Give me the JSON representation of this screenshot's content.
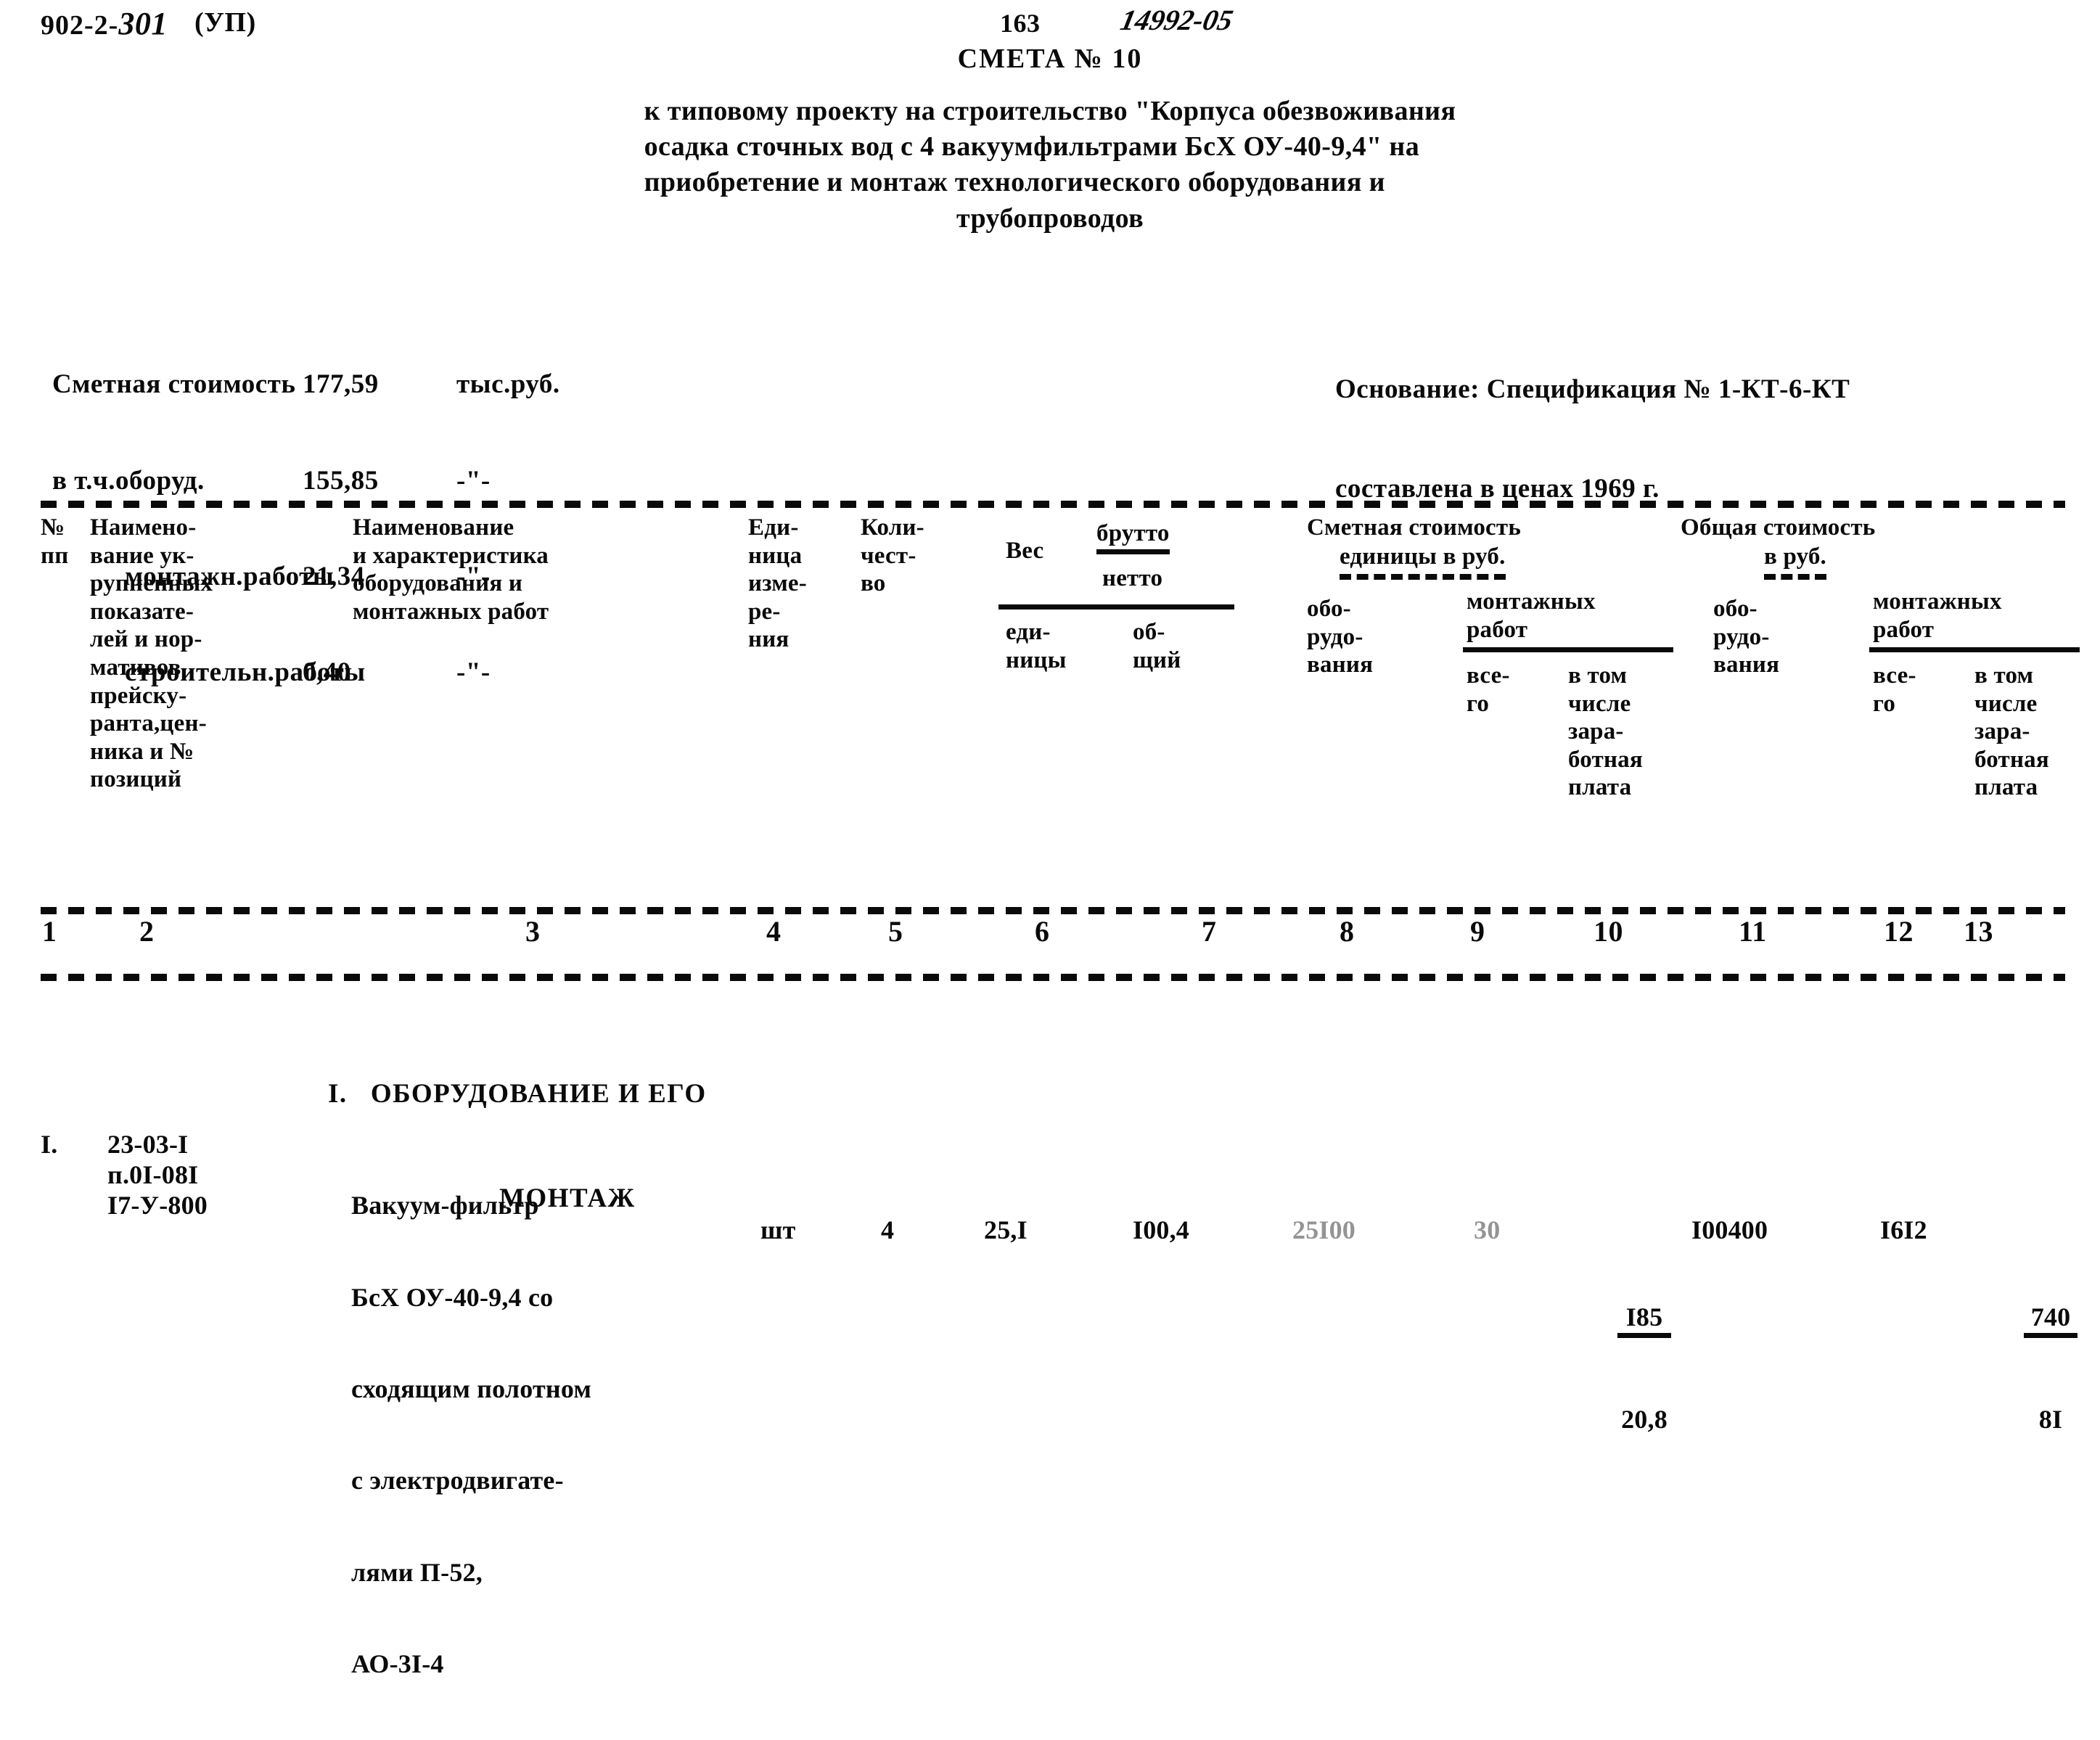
{
  "header": {
    "project_code_typed": "902-2-",
    "project_code_hand": "301",
    "stage_mark": "(УП)",
    "page_number": "163",
    "archive_number": "14992-05"
  },
  "title": {
    "doc_title": "СМЕТА № 10",
    "lines": [
      "к типовому проекту на строительство \"Корпуса обезвоживания",
      "осадка сточных вод с 4 вакуумфильтрами БсХ ОУ-40-9,4\" на",
      "приобретение и монтаж технологического оборудования и",
      "трубопроводов"
    ]
  },
  "summary": {
    "rows": [
      {
        "label": "Сметная стоимость",
        "value": "177,59",
        "unit": "тыс.руб."
      },
      {
        "label": "в т.ч.оборуд.",
        "value": "155,85",
        "unit": "-\"-"
      },
      {
        "label": "монтажн.работы",
        "value": "21,34",
        "unit": "-\"-"
      },
      {
        "label": "строительн.работы",
        "value": "0,40",
        "unit": "-\"-"
      }
    ]
  },
  "basis": {
    "line1": "Основание: Спецификация № 1-КТ-6-КТ",
    "line2": "составлена в ценах 1969 г."
  },
  "table": {
    "headers": {
      "col1": "№\nпп",
      "col2": "Наимено-\nвание ук-\nрупненных\nпоказате-\nлей и нор-\nмативов\nпрейску-\nранта,цен-\nника и №\nпозиций",
      "col3": "Наименование\nи характеристика\nоборудования и\nмонтажных работ",
      "col4": "Еди-\nница\nизме-\nре-\nния",
      "col5": "Коли-\nчест-\nво",
      "weight_label": "Вес",
      "weight_gross": "брутто",
      "weight_net": "нетто",
      "col6": "еди-\nницы",
      "col7": "об-\nщий",
      "unit_cost_group": "Сметная стоимость",
      "unit_cost_group_underlined": "единицы в руб.",
      "col8": "обо-\nрудо-\nвания",
      "col9_group": "монтажных\nработ",
      "col9": "все-\nго",
      "col10": "в том\nчисле\nзара-\nботная\nплата",
      "total_cost_group": "Общая стоимость",
      "total_cost_group_underlined": "в руб.",
      "col11": "обо-\nрудо-\nвания",
      "col12_group": "монтажных\nработ",
      "col12": "все-\nго",
      "col13": "в том\nчисле\nзара-\nботная\nплата"
    },
    "column_numbers": [
      "1",
      "2",
      "3",
      "4",
      "5",
      "6",
      "7",
      "8",
      "9",
      "10",
      "11",
      "12",
      "13"
    ],
    "sections": [
      {
        "number": "I.",
        "title_line1": "ОБОРУДОВАНИЕ И ЕГО",
        "title_line2": "МОНТАЖ"
      }
    ],
    "rows": [
      {
        "no": "I.",
        "code": "23-03-I\nп.0I-08I\nI7-У-800",
        "name_lines": [
          "Вакуум-фильтр",
          "БсХ ОУ-40-9,4 со",
          "сходящим полотном",
          "с электродвигате-",
          "лями П-52,",
          "АО-3I-4"
        ],
        "unit": "шт",
        "qty": "4",
        "weight_unit": "25,I",
        "weight_total": "I00,4",
        "unit_cost_equipment": "25I00",
        "unit_cost_install_total": "30",
        "unit_cost_install_wage_num": "I85",
        "unit_cost_install_wage_den": "20,8",
        "total_equipment": "I00400",
        "total_install_num": "I6I2",
        "total_install_wage_num": "740",
        "total_install_wage_den": "8I"
      }
    ]
  }
}
